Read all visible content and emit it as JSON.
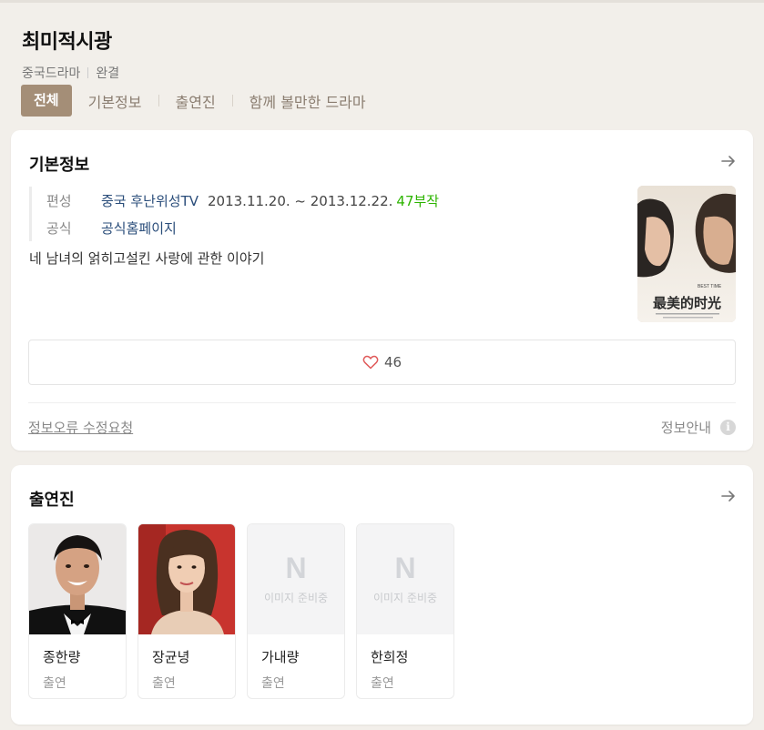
{
  "header": {
    "title": "최미적시광",
    "category": "중국드라마",
    "status": "완결"
  },
  "tabs": [
    {
      "label": "전체",
      "active": true
    },
    {
      "label": "기본정보",
      "active": false
    },
    {
      "label": "출연진",
      "active": false
    },
    {
      "label": "함께 볼만한 드라마",
      "active": false
    }
  ],
  "basic_info": {
    "section_title": "기본정보",
    "rows": [
      {
        "label": "편성",
        "channel": "중국 후난위성TV",
        "dates": "2013.11.20. ~ 2013.12.22.",
        "episodes": "47부작"
      },
      {
        "label": "공식",
        "link": "공식홈페이지"
      }
    ],
    "description": "네 남녀의 얽히고설킨 사랑에 관한 이야기",
    "poster": {
      "line1": "BEST TIME",
      "line2": "最美的时光"
    },
    "like_count": "46",
    "report_link": "정보오류 수정요청",
    "info_guide": "정보안내",
    "info_icon": "i"
  },
  "cast": {
    "section_title": "출연진",
    "placeholder_letter": "N",
    "placeholder_text": "이미지 준비중",
    "members": [
      {
        "name": "종한량",
        "role": "출연",
        "has_photo": true
      },
      {
        "name": "장균녕",
        "role": "출연",
        "has_photo": true
      },
      {
        "name": "가내량",
        "role": "출연",
        "has_photo": false
      },
      {
        "name": "한희정",
        "role": "출연",
        "has_photo": false
      }
    ]
  },
  "colors": {
    "accent_tab": "#a48e77",
    "link": "#2a4d7a",
    "episodes_green": "#2db400",
    "heart": "#e05a5a"
  }
}
